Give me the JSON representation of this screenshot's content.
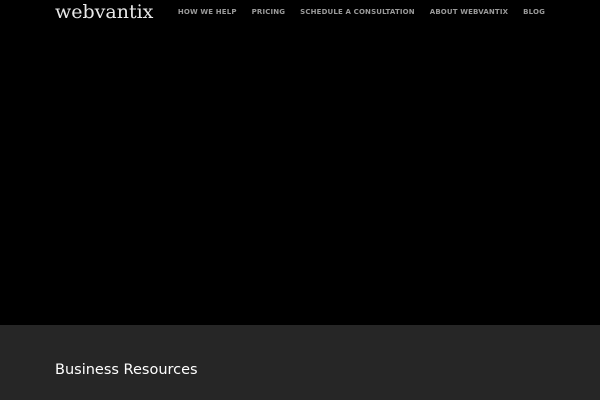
{
  "header": {
    "logo_text": "webvantix",
    "nav": [
      {
        "label": "HOW WE HELP"
      },
      {
        "label": "PRICING"
      },
      {
        "label": "SCHEDULE A CONSULTATION"
      },
      {
        "label": "ABOUT WEBVANTIX"
      },
      {
        "label": "BLOG"
      }
    ]
  },
  "resources": {
    "title": "Business Resources"
  },
  "colors": {
    "page_background": "#000000",
    "section_background": "#262626",
    "logo_text": "#e8e8e8",
    "nav_text": "#9a9a9a",
    "heading_text": "#ffffff"
  }
}
